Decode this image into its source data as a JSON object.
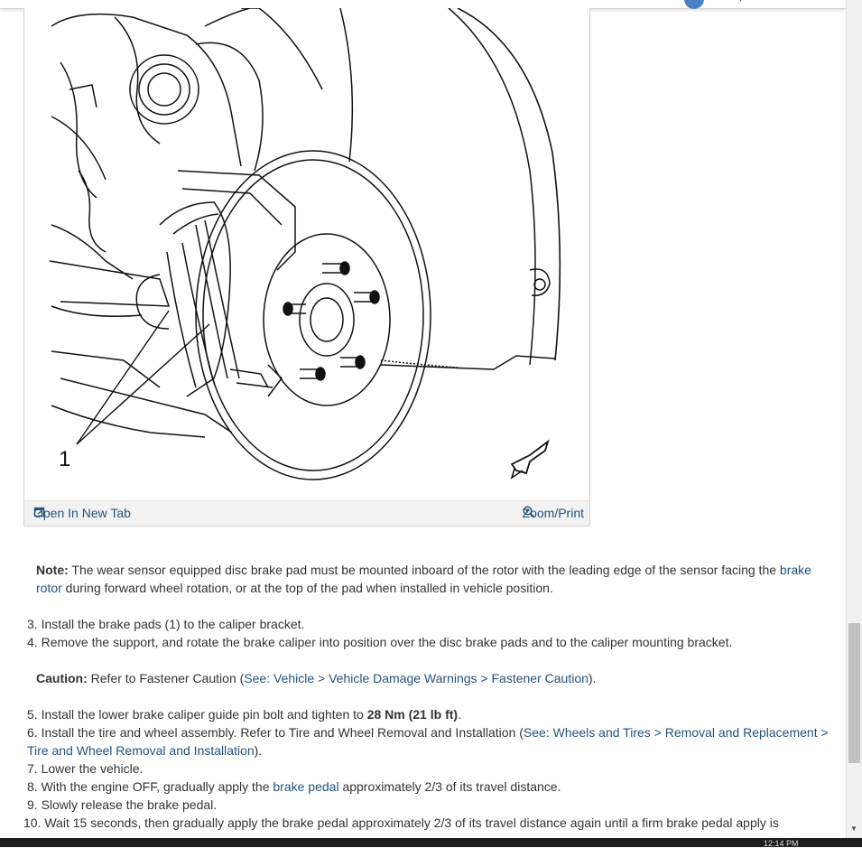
{
  "figure": {
    "callout_label": "1",
    "toolbar": {
      "open_label": "Open In New Tab",
      "zoom_label": "Zoom/Print"
    }
  },
  "note": {
    "prefix": "Note:",
    "text_before": " The wear sensor equipped disc brake pad must be mounted inboard of the rotor with the leading edge of the sensor facing the ",
    "link": "brake rotor",
    "text_after": " during forward wheel rotation, or at the top of the pad when installed in vehicle position."
  },
  "steps_a": [
    {
      "num": "3.",
      "text": " Install the brake pads (1) to the caliper bracket."
    },
    {
      "num": "4.",
      "text": " Remove the support, and rotate the brake caliper into position over the disc brake pads and to the caliper mounting bracket."
    }
  ],
  "caution": {
    "prefix": "Caution:",
    "text_before": " Refer to Fastener Caution (",
    "link": "See: Vehicle > Vehicle Damage Warnings > Fastener Caution",
    "text_after": ")."
  },
  "step5": {
    "num": "5.",
    "text_before": " Install the lower brake caliper guide pin bolt and tighten to ",
    "bold": "28 Nm (21 lb ft)",
    "text_after": "."
  },
  "step6": {
    "num": "6.",
    "text_before": " Install the tire and wheel assembly. Refer to Tire and Wheel Removal and Installation (",
    "link": "See: Wheels and Tires > Removal and Replacement > Tire and Wheel Removal and Installation",
    "text_after": ")."
  },
  "step7": {
    "num": "7.",
    "text": " Lower the vehicle."
  },
  "step8": {
    "num": "8.",
    "text_before": " With the engine OFF, gradually apply the ",
    "link": "brake pedal",
    "text_after": " approximately 2/3 of its travel distance."
  },
  "step9": {
    "num": "9.",
    "text": " Slowly release the brake pedal."
  },
  "step10": {
    "num": "10.",
    "text": " Wait 15 seconds, then gradually apply the brake pedal approximately 2/3 of its travel distance again until a firm brake pedal apply is"
  },
  "taskbar": {
    "clock": "12:14 PM"
  },
  "colors": {
    "link": "#23527c",
    "text": "#333333",
    "toolbar_bg": "#f2f2f2"
  }
}
